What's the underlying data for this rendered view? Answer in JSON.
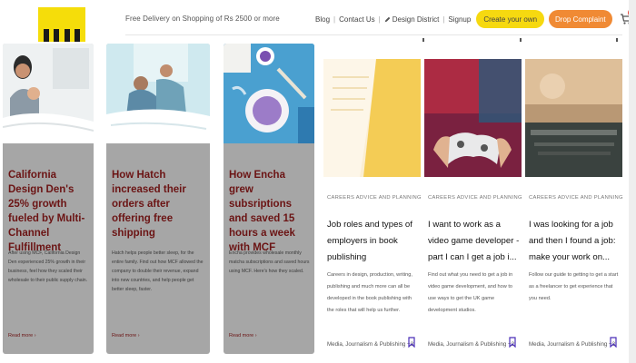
{
  "header": {
    "logo_label": "Logo",
    "promo_text": "Free Delivery on Shopping of Rs 2500 or more",
    "nav": [
      {
        "label": "Blog"
      },
      {
        "label": "Contact Us"
      },
      {
        "label": "Design District"
      },
      {
        "label": "Signup"
      }
    ],
    "create_button": "Create your own",
    "complaint_button": "Drop Complaint",
    "cart_count": "0"
  },
  "case_studies": [
    {
      "title": "California Design Den's 25% growth fueled by Multi-Channel Fulfillment",
      "description": "After using MCF, California Design Den experienced 25% growth in their business, feel how they scaled their wholesale to their public supply chain.",
      "read_more": "Read more ›"
    },
    {
      "title": "How Hatch increased their orders after offering free shipping",
      "description": "Hatch helps people better sleep, for the entire family. Find out how MCF allowed the company to double their revenue, expand into new countries, and help people get better sleep, faster.",
      "read_more": "Read more ›"
    },
    {
      "title": "How Encha grew subsriptions and saved 15 hours a week with MCF",
      "description": "Encha provides wholesale monthly matcha subscriptions and saved hours using MCF. Here's how they scaled.",
      "read_more": "Read more ›"
    }
  ],
  "articles": [
    {
      "category": "CAREERS ADVICE AND PLANNING",
      "title": "Job roles and types of employers in book publishing",
      "description": "Careers in design, production, writing, publishing and much more can all be developed in the book publishing with the roles that will help us further.",
      "footer": "Media, Journalism & Publishing +3"
    },
    {
      "category": "CAREERS ADVICE AND PLANNING",
      "title": "I want to work as a video game developer - part I can I get a job i...",
      "description": "Find out what you need to get a job in video game development, and how to use ways to get the UK game development studios.",
      "footer": "Media, Journalism & Publishing +2"
    },
    {
      "category": "CAREERS ADVICE AND PLANNING",
      "title": "I was looking for a job and then I found a job: make your work on...",
      "description": "Follow our guide to getting to get a start as a freelancer to get experience that you need.",
      "footer": "Media, Journalism & Publishing +3"
    }
  ],
  "colors": {
    "case_card_bg": "#a6a6a6",
    "case_title": "#6b1414",
    "create_button_bg": "#f6d910",
    "complaint_button_bg": "#f08a34",
    "logo_bg": "#f5dd0a",
    "bookmark": "#4b2fb8"
  },
  "icons": [
    "pencil-icon",
    "cart-icon",
    "bookmark-icon"
  ]
}
